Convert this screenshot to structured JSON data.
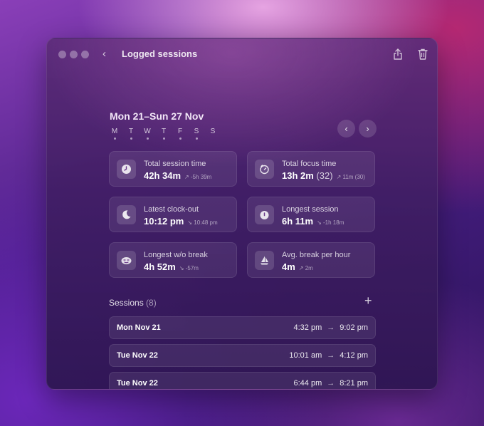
{
  "window": {
    "title": "Logged sessions"
  },
  "week": {
    "range": "Mon 21–Sun 27 Nov",
    "days": [
      "M",
      "T",
      "W",
      "T",
      "F",
      "S",
      "S"
    ]
  },
  "stats": [
    {
      "label": "Total session time",
      "value": "42h 34m",
      "extra": "",
      "trend": "↗ -5h 39m",
      "icon": "clock-icon"
    },
    {
      "label": "Total focus time",
      "value": "13h 2m",
      "extra": "(32)",
      "trend": "↗ 11m (30)",
      "icon": "timer-icon"
    },
    {
      "label": "Latest clock-out",
      "value": "10:12 pm",
      "extra": "",
      "trend": "↘ 10:48 pm",
      "icon": "moon-icon"
    },
    {
      "label": "Longest session",
      "value": "6h 11m",
      "extra": "",
      "trend": "↘ -1h 18m",
      "icon": "stopwatch-icon"
    },
    {
      "label": "Longest w/o break",
      "value": "4h 52m",
      "extra": "",
      "trend": "↘ -57m",
      "icon": "tired-icon"
    },
    {
      "label": "Avg. break per hour",
      "value": "4m",
      "extra": "",
      "trend": "↗ 2m",
      "icon": "sailboat-icon"
    }
  ],
  "sessions": {
    "label": "Sessions",
    "count": "(8)",
    "rows": [
      {
        "date": "Mon Nov 21",
        "start": "4:32 pm",
        "end": "9:02 pm"
      },
      {
        "date": "Tue Nov 22",
        "start": "10:01 am",
        "end": "4:12 pm"
      },
      {
        "date": "Tue Nov 22",
        "start": "6:44 pm",
        "end": "8:21 pm"
      }
    ],
    "arrow": "→"
  },
  "colors": {
    "accent": "#ffffff",
    "window": "#4a2470"
  }
}
